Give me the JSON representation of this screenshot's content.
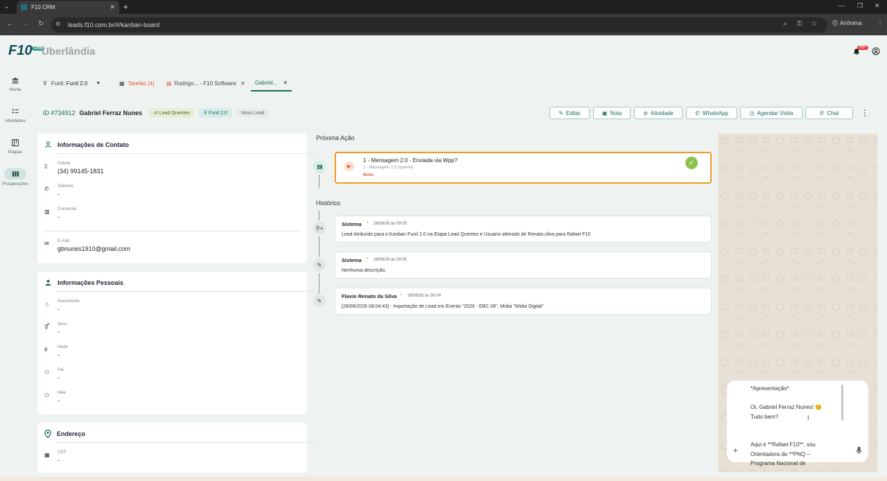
{
  "browser": {
    "tab_title": "F10 CRM",
    "url": "leads.f10.com.br/#/kanban-board",
    "profile_label": "Anônima"
  },
  "app": {
    "logo": "F10",
    "logo_badge": "CRM",
    "city": "Uberlândia",
    "notification_badge": "99+"
  },
  "sidebar": [
    {
      "label": "Home",
      "icon": "bank-icon"
    },
    {
      "label": "Atividades",
      "icon": "checklist-icon"
    },
    {
      "label": "Etapas",
      "icon": "board-icon"
    },
    {
      "label": "Prospecções",
      "icon": "columns-icon",
      "active": true
    }
  ],
  "tabs": {
    "funnel_label": "Funil:",
    "funnel_value": "Funil 2.0",
    "tasks": "Tarefas (4)",
    "tab_company": "Rodrigo... - F10 Software",
    "tab_lead": "Gabriel..."
  },
  "lead": {
    "id": "ID #734912",
    "name": "Gabriel Ferraz Nunes",
    "chips": [
      "Lead Quentes",
      "Funil 2.0",
      "Novo Lead"
    ]
  },
  "actions": [
    "Editar",
    "Nota",
    "Atividade",
    "WhatsApp",
    "Agendar Visita",
    "Chat"
  ],
  "contact": {
    "title": "Informações de Contato",
    "fields": [
      {
        "label": "Celular",
        "value": "(34) 99145-1831"
      },
      {
        "label": "Telefone",
        "value": "-"
      },
      {
        "label": "Comercial",
        "value": "-"
      },
      {
        "label": "E-mail",
        "value": "gbnunes1910@gmail.com"
      }
    ]
  },
  "personal": {
    "title": "Informações Pessoais",
    "fields": [
      {
        "label": "Nascimento",
        "value": "-"
      },
      {
        "label": "Sexo",
        "value": "-"
      },
      {
        "label": "Idade",
        "value": "-"
      },
      {
        "label": "Pai",
        "value": "-"
      },
      {
        "label": "Mãe",
        "value": "-"
      }
    ]
  },
  "address": {
    "title": "Endereço",
    "fields": [
      {
        "label": "CEP",
        "value": "-"
      }
    ]
  },
  "next_action": {
    "section_title": "Próxima Ação",
    "title": "1 - Mensagem 2.0 - Enviada via Wpp?",
    "subtitle": "1 - Mensagem 2.0 (quente)",
    "status": "Novo"
  },
  "history": {
    "section_title": "Histórico",
    "items": [
      {
        "author": "Sistema",
        "time": "28/08/26 às 09:05",
        "text": "Lead Atribuído para o Kanban Funil 2.0 na Etapa Lead Quentes e Usuário alterado de Renato.silva para Rafael F10"
      },
      {
        "author": "Sistema",
        "time": "28/08/26 às 09:05",
        "text": "Nenhuma descrição."
      },
      {
        "author": "Flavio Renato da Silva",
        "time": "28/08/26 às 08:04",
        "text": "[28/08/2026 08:04:43] - Importação de Lead em Evento \"2026 - EBC 08\", Mídia \"Mídia Digital\""
      }
    ]
  },
  "chat": {
    "lines": [
      "*Apresentação*",
      "",
      "Oi, Gabriel Ferraz Nunes! 😊",
      "Tudo bem?",
      "",
      "",
      "Aqui é **Rafael F10**, sou",
      "Orientadora do **PNQ –",
      "Programa Nacional de"
    ]
  },
  "colors": {
    "accent": "#176a5b",
    "orange": "#f29a1f",
    "danger": "#e53935"
  }
}
